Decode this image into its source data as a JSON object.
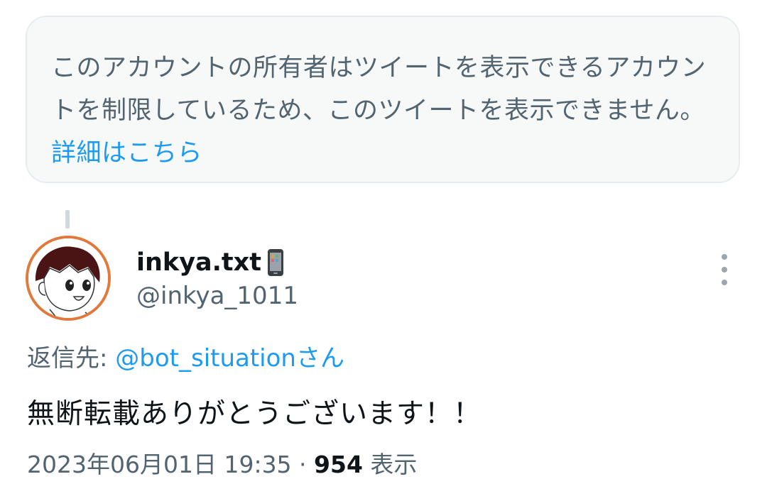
{
  "notice": {
    "message": "このアカウントの所有者はツイートを表示できるアカウントを制限しているため、このツイートを表示できません。",
    "link": "詳細はこちら"
  },
  "tweet": {
    "display_name": "inkya.txt",
    "name_emoji_icon": "mobile-phone-icon",
    "handle": "@inkya_1011",
    "reply_label": "返信先: ",
    "reply_mention": "@bot_situation",
    "reply_suffix": "さん",
    "text": "無断転載ありがとうございます！！",
    "timestamp": "2023年06月01日 19:35",
    "separator": " · ",
    "view_count": "954",
    "view_label": " 表示"
  },
  "colors": {
    "link": "#1d9bf0",
    "secondary_text": "#536471",
    "primary_text": "#0f1419",
    "notice_bg": "#f7f9f9",
    "avatar_border": "#e07a3c"
  }
}
